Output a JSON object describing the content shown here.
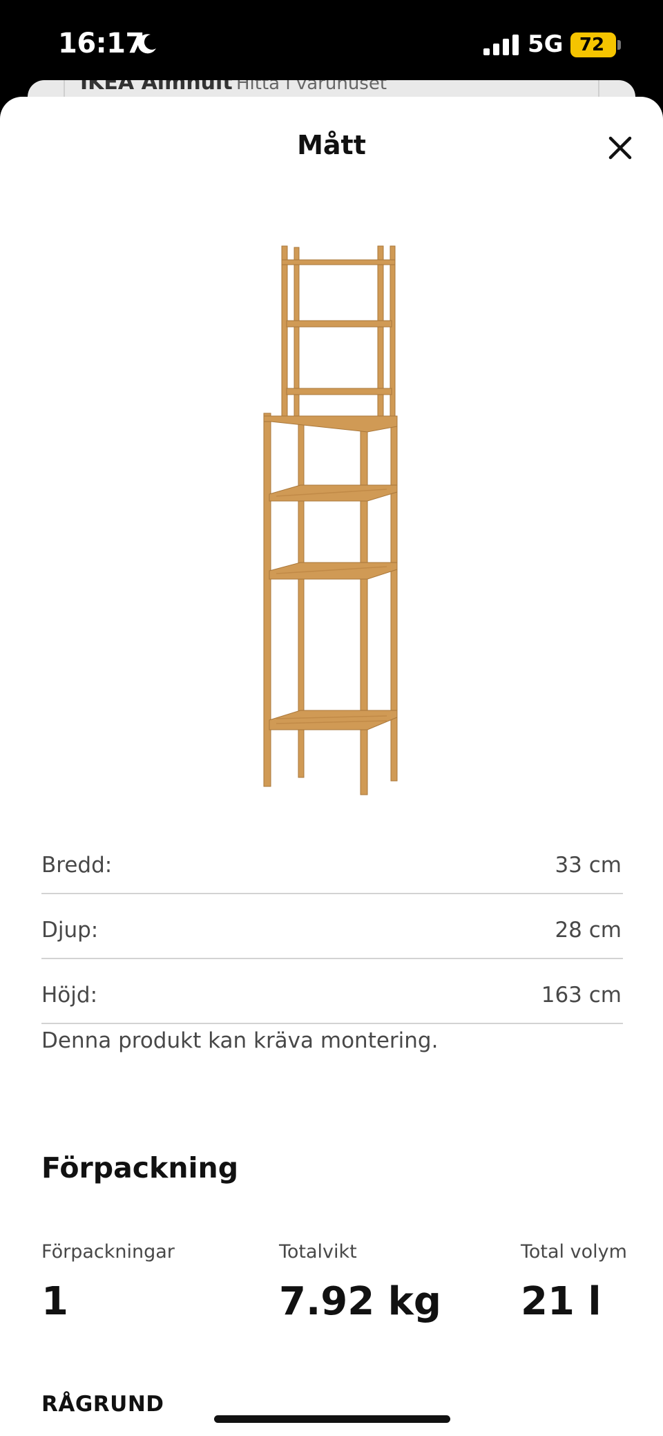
{
  "status_bar": {
    "time": "16:17",
    "network": "5G",
    "battery": "72"
  },
  "background": {
    "store": "IKEA Almhult",
    "find": "Hitta i varuhuset"
  },
  "sheet": {
    "title": "Mått"
  },
  "dimensions": [
    {
      "label": "Bredd:",
      "value": "33 cm"
    },
    {
      "label": "Djup:",
      "value": "28 cm"
    },
    {
      "label": "Höjd:",
      "value": "163 cm"
    }
  ],
  "assembly_note": "Denna produkt kan kräva montering.",
  "packaging": {
    "heading": "Förpackning",
    "items": [
      {
        "label": "Förpackningar",
        "value": "1"
      },
      {
        "label": "Totalvikt",
        "value": "7.92 kg"
      },
      {
        "label": "Total volym",
        "value": "21 l"
      }
    ]
  },
  "product_name": "RÅGRUND",
  "colors": {
    "accent_battery": "#f5c400",
    "wood": "#d09a55"
  }
}
